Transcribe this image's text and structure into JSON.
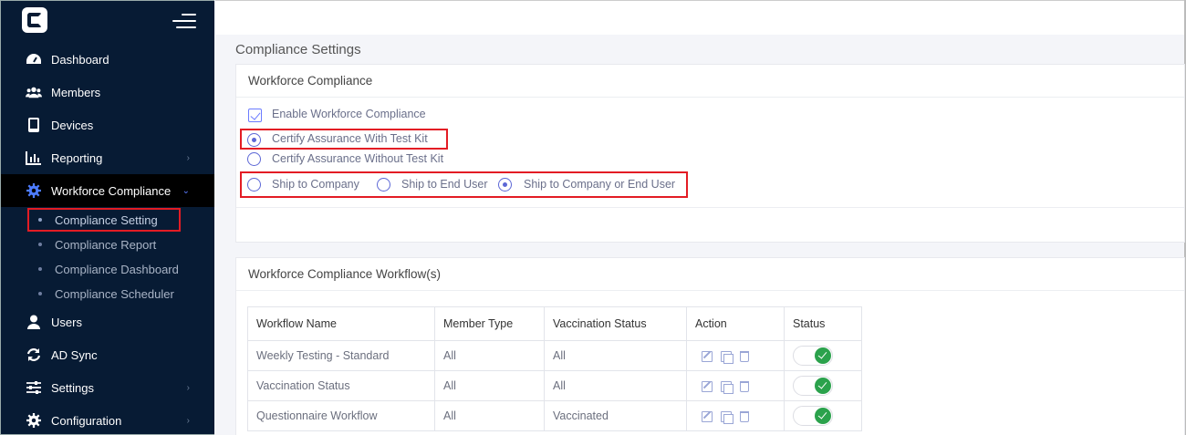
{
  "sidebar": {
    "items": [
      {
        "label": "Dashboard",
        "icon": "dashboard-icon"
      },
      {
        "label": "Members",
        "icon": "members-icon"
      },
      {
        "label": "Devices",
        "icon": "devices-icon"
      },
      {
        "label": "Reporting",
        "icon": "reporting-icon"
      },
      {
        "label": "Workforce Compliance",
        "icon": "gear-icon"
      },
      {
        "label": "Users",
        "icon": "user-icon"
      },
      {
        "label": "AD Sync",
        "icon": "sync-icon"
      },
      {
        "label": "Settings",
        "icon": "sliders-icon"
      },
      {
        "label": "Configuration",
        "icon": "gear-icon"
      }
    ],
    "sub_items": [
      {
        "label": "Compliance Setting"
      },
      {
        "label": "Compliance Report"
      },
      {
        "label": "Compliance Dashboard"
      },
      {
        "label": "Compliance Scheduler"
      }
    ]
  },
  "page": {
    "title": "Compliance Settings"
  },
  "compliance_card": {
    "title": "Workforce Compliance",
    "enable_label": "Enable Workforce Compliance",
    "enable_checked": true,
    "certify_with": "Certify Assurance With Test Kit",
    "certify_without": "Certify Assurance Without Test Kit",
    "certify_selected": "with",
    "ship_company": "Ship to Company",
    "ship_end_user": "Ship to End User",
    "ship_either": "Ship to Company or End User",
    "ship_selected": "either"
  },
  "workflow_card": {
    "title": "Workforce Compliance Workflow(s)",
    "columns": [
      "Workflow Name",
      "Member Type",
      "Vaccination Status",
      "Action",
      "Status"
    ],
    "rows": [
      {
        "name": "Weekly Testing - Standard",
        "member_type": "All",
        "vaccination": "All",
        "status_on": true
      },
      {
        "name": "Vaccination Status",
        "member_type": "All",
        "vaccination": "All",
        "status_on": true
      },
      {
        "name": "Questionnaire Workflow",
        "member_type": "All",
        "vaccination": "Vaccinated",
        "status_on": true
      }
    ]
  },
  "colors": {
    "sidebar_bg": "#071b34",
    "accent": "#5c67d6",
    "highlight": "#e31c24",
    "toggle_on": "#2ba24c"
  }
}
